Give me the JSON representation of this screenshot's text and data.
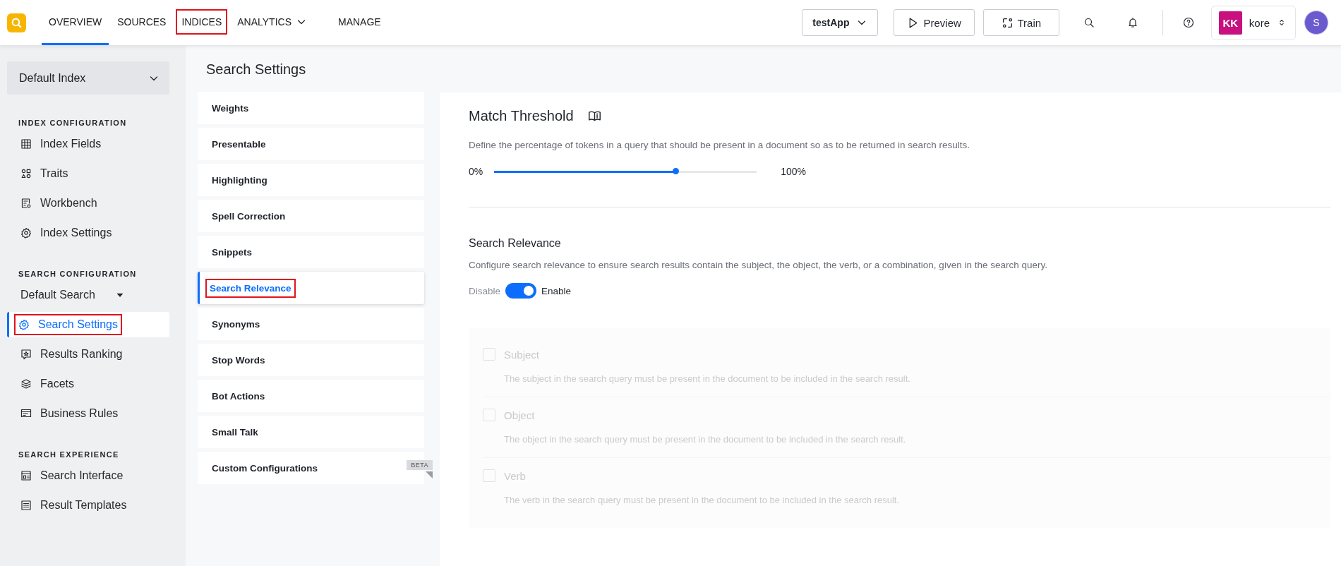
{
  "nav": {
    "tabs": [
      {
        "label": "OVERVIEW",
        "selected": true,
        "highlighted": false,
        "dropdown": false
      },
      {
        "label": "SOURCES",
        "selected": false,
        "highlighted": false,
        "dropdown": false
      },
      {
        "label": "INDICES",
        "selected": false,
        "highlighted": true,
        "dropdown": false
      },
      {
        "label": "ANALYTICS",
        "selected": false,
        "highlighted": false,
        "dropdown": true
      },
      {
        "label": "MANAGE",
        "selected": false,
        "highlighted": false,
        "dropdown": false
      }
    ]
  },
  "toolbar": {
    "app_selector": {
      "value": "testApp"
    },
    "buttons": [
      {
        "label": "Preview",
        "kind": "play"
      },
      {
        "label": "Train",
        "kind": "train"
      }
    ],
    "account": {
      "initials": "KK",
      "name": "kore"
    },
    "avatar": {
      "initial": "S"
    }
  },
  "sidebar": {
    "index_selector": {
      "value": "Default Index"
    },
    "sections": [
      {
        "heading": "INDEX CONFIGURATION",
        "items": [
          {
            "label": "Index Fields",
            "kind": "item",
            "selected": false,
            "highlighted": false
          },
          {
            "label": "Traits",
            "kind": "item",
            "selected": false,
            "highlighted": false
          },
          {
            "label": "Workbench",
            "kind": "item",
            "selected": false,
            "highlighted": false
          },
          {
            "label": "Index Settings",
            "kind": "item",
            "selected": false,
            "highlighted": false
          }
        ]
      },
      {
        "heading": "SEARCH CONFIGURATION",
        "items": [
          {
            "label": "Default Search",
            "kind": "dropdown",
            "selected": false,
            "highlighted": false
          },
          {
            "label": "Search Settings",
            "kind": "item",
            "selected": true,
            "highlighted": true
          },
          {
            "label": "Results Ranking",
            "kind": "item",
            "selected": false,
            "highlighted": false
          },
          {
            "label": "Facets",
            "kind": "item",
            "selected": false,
            "highlighted": false
          },
          {
            "label": "Business Rules",
            "kind": "item",
            "selected": false,
            "highlighted": false
          }
        ]
      },
      {
        "heading": "SEARCH EXPERIENCE",
        "items": [
          {
            "label": "Search Interface",
            "kind": "item",
            "selected": false,
            "highlighted": false
          },
          {
            "label": "Result Templates",
            "kind": "item",
            "selected": false,
            "highlighted": false
          }
        ]
      }
    ]
  },
  "settings_menu": {
    "title": "Search Settings",
    "items": [
      {
        "label": "Weights",
        "selected": false,
        "highlighted": false
      },
      {
        "label": "Presentable",
        "selected": false,
        "highlighted": false
      },
      {
        "label": "Highlighting",
        "selected": false,
        "highlighted": false
      },
      {
        "label": "Spell Correction",
        "selected": false,
        "highlighted": false
      },
      {
        "label": "Snippets",
        "selected": false,
        "highlighted": false
      },
      {
        "label": "Search Relevance",
        "selected": true,
        "highlighted": true
      },
      {
        "label": "Synonyms",
        "selected": false,
        "highlighted": false
      },
      {
        "label": "Stop Words",
        "selected": false,
        "highlighted": false
      },
      {
        "label": "Bot Actions",
        "selected": false,
        "highlighted": false
      },
      {
        "label": "Small Talk",
        "selected": false,
        "highlighted": false
      },
      {
        "label": "Custom Configurations",
        "selected": false,
        "highlighted": false,
        "badge": "BETA"
      }
    ]
  },
  "match_threshold": {
    "title": "Match Threshold",
    "description": "Define the percentage of tokens in a query that should be present in a document so as to be returned in search results.",
    "min_label": "0%",
    "max_label": "100%",
    "level": 0.69
  },
  "search_relevance": {
    "title": "Search Relevance",
    "description": "Configure search relevance to ensure search results contain the subject, the object, the verb, or a combination, given in the search query.",
    "off_label": "Disable",
    "on_label": "Enable",
    "on": true,
    "options": [
      {
        "label": "Subject",
        "description": "The subject in the search query must be present in the document to be included in the search result.",
        "checked": false,
        "disabled": true
      },
      {
        "label": "Object",
        "description": "The object in the search query must be present in the document to be included in the search result.",
        "checked": false,
        "disabled": true
      },
      {
        "label": "Verb",
        "description": "The verb in the search query must be present in the document to be included in the search result.",
        "checked": false,
        "disabled": true
      }
    ]
  }
}
